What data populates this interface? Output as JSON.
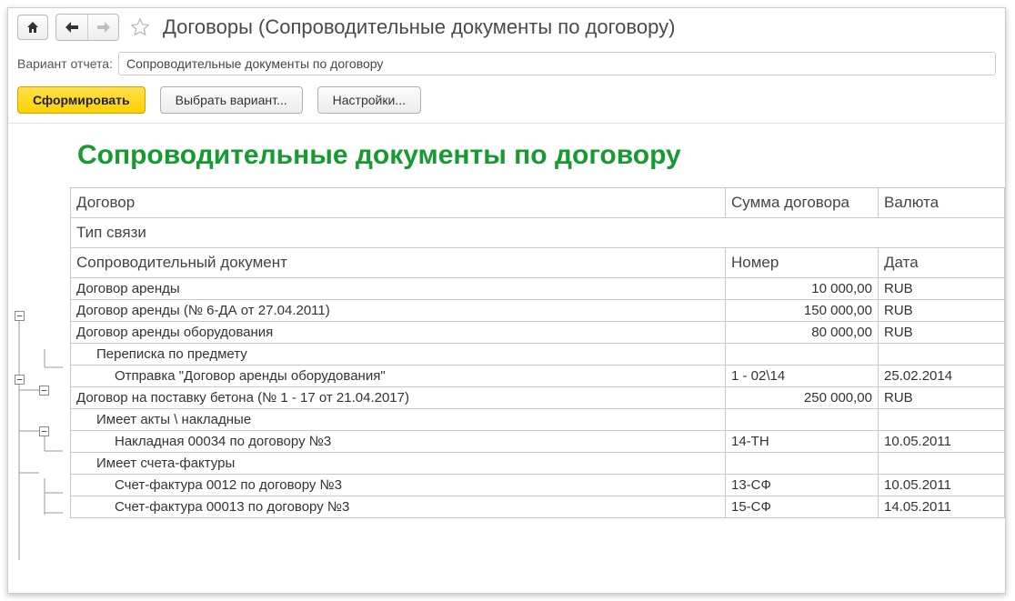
{
  "header": {
    "title": "Договоры (Сопроводительные документы по договору)"
  },
  "form": {
    "variant_label": "Вариант отчета:",
    "variant_value": "Сопроводительные документы по договору"
  },
  "toolbar": {
    "run_label": "Сформировать",
    "choose_label": "Выбрать вариант...",
    "settings_label": "Настройки..."
  },
  "report": {
    "title": "Сопроводительные документы по договору",
    "headers": {
      "contract": "Договор",
      "sum": "Сумма договора",
      "currency": "Валюта",
      "link_type": "Тип связи",
      "accompanying_doc": "Сопроводительный документ",
      "number": "Номер",
      "date": "Дата"
    },
    "rows": [
      {
        "level": 0,
        "c1": "Договор аренды",
        "c2": "10 000,00",
        "c2_num": true,
        "c3": "RUB"
      },
      {
        "level": 0,
        "c1": "Договор аренды (№ 6-ДА от 27.04.2011)",
        "c2": "150 000,00",
        "c2_num": true,
        "c3": "RUB"
      },
      {
        "level": 0,
        "c1": "Договор аренды оборудования",
        "c2": "80 000,00",
        "c2_num": true,
        "c3": "RUB"
      },
      {
        "level": 1,
        "c1": "Переписка по предмету",
        "c2": "",
        "c3": ""
      },
      {
        "level": 2,
        "c1": "Отправка \"Договор аренды оборудования\"",
        "c2": "1 - 02\\14",
        "c3": "25.02.2014"
      },
      {
        "level": 0,
        "c1": "Договор на поставку бетона (№ 1 - 17 от 21.04.2017)",
        "c2": "250 000,00",
        "c2_num": true,
        "c3": "RUB"
      },
      {
        "level": 1,
        "c1": "Имеет акты \\ накладные",
        "c2": "",
        "c3": ""
      },
      {
        "level": 2,
        "c1": "Накладная 00034 по договору №3",
        "c2": "14-ТН",
        "c3": "10.05.2011"
      },
      {
        "level": 1,
        "c1": "Имеет счета-фактуры",
        "c2": "",
        "c3": ""
      },
      {
        "level": 2,
        "c1": "Счет-фактура 0012 по договору №3",
        "c2": "13-СФ",
        "c3": "10.05.2011"
      },
      {
        "level": 2,
        "c1": "Счет-фактура 00013 по договору №3",
        "c2": "15-СФ",
        "c3": "14.05.2011"
      }
    ]
  }
}
